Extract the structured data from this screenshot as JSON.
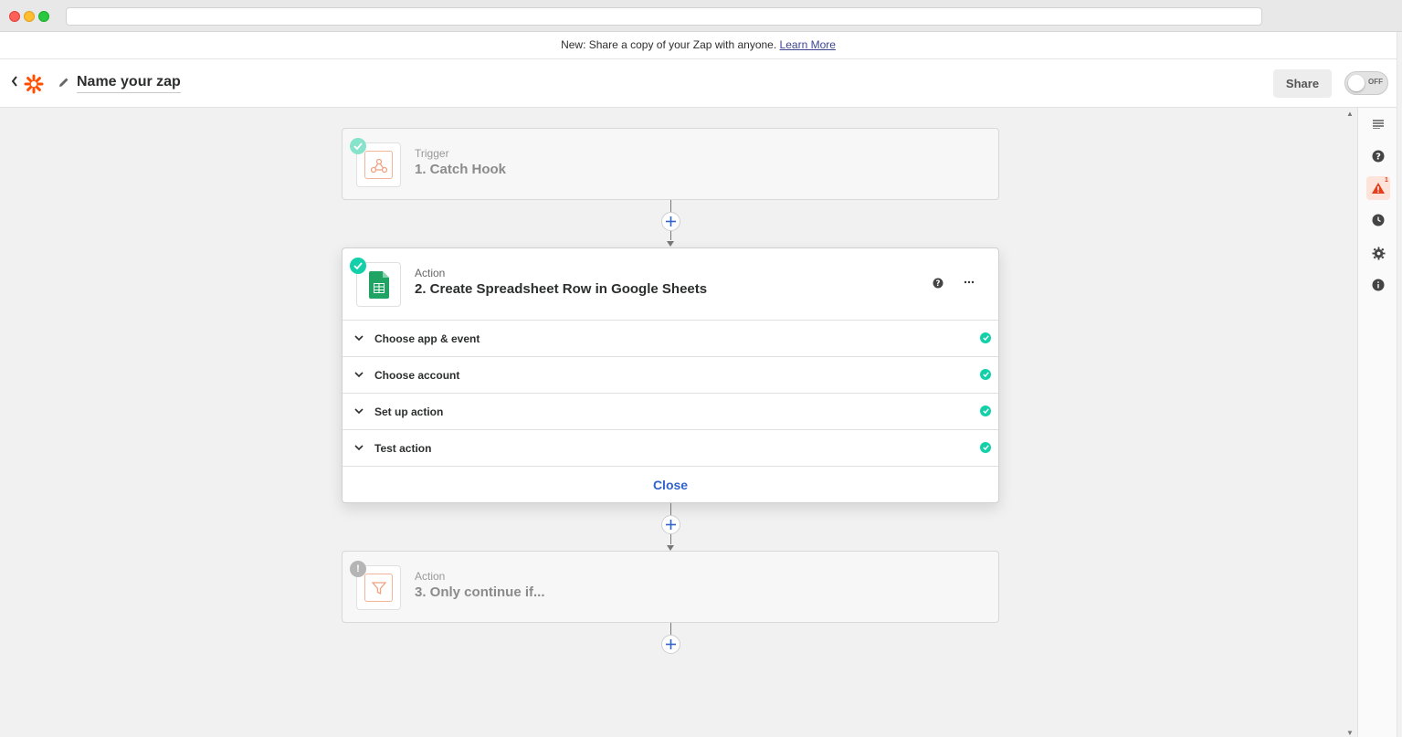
{
  "banner": {
    "text": "New: Share a copy of your Zap with anyone.",
    "link": "Learn More"
  },
  "header": {
    "zap_name": "Name your zap",
    "share_label": "Share",
    "toggle_label": "OFF"
  },
  "sidebar": {
    "icons": [
      "details-icon",
      "help-icon",
      "warning-icon",
      "history-icon",
      "settings-icon",
      "info-icon"
    ],
    "warning_count": "1"
  },
  "steps": [
    {
      "type": "Trigger",
      "title": "1. Catch Hook",
      "icon": "webhook-icon",
      "status": "complete"
    },
    {
      "type": "Action",
      "title": "2. Create Spreadsheet Row in Google Sheets",
      "icon": "google-sheets-icon",
      "status": "complete",
      "sections": [
        {
          "label": "Choose app & event",
          "status": "complete"
        },
        {
          "label": "Choose account",
          "status": "complete"
        },
        {
          "label": "Set up action",
          "status": "complete"
        },
        {
          "label": "Test action",
          "status": "complete"
        }
      ],
      "close_label": "Close"
    },
    {
      "type": "Action",
      "title": "3. Only continue if...",
      "icon": "filter-icon",
      "status": "warning"
    }
  ],
  "colors": {
    "accent": "#ff4f00",
    "success": "#13d0ab",
    "link": "#3064c9",
    "sheets_green": "#20a464"
  }
}
